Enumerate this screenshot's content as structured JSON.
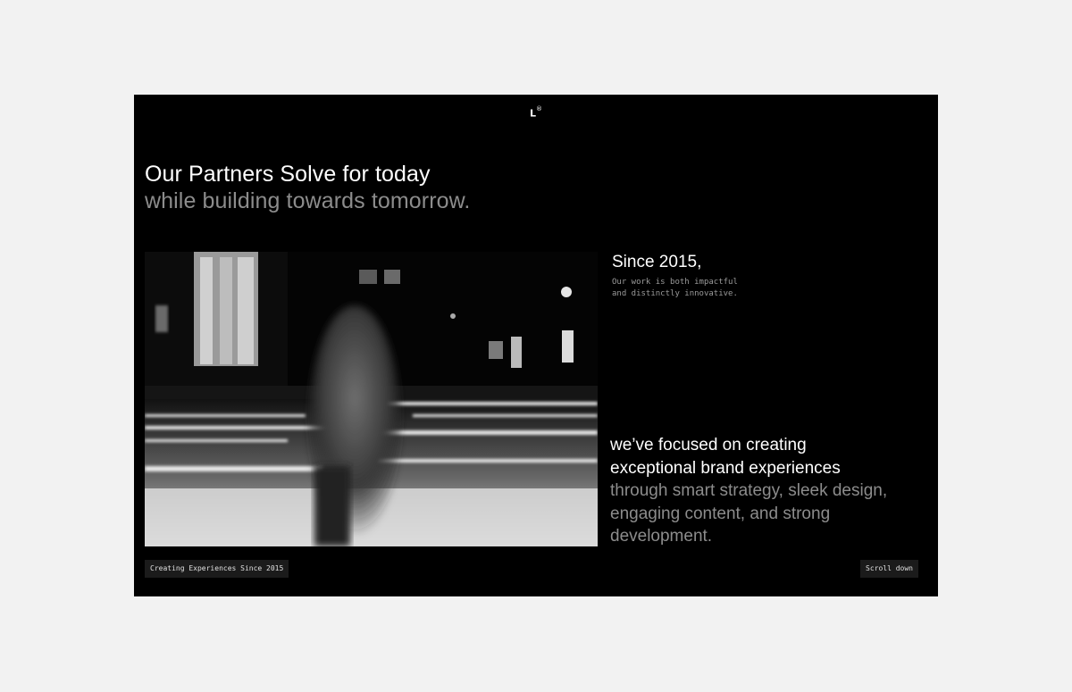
{
  "brand": {
    "logo_letter": "L",
    "logo_mark": "®"
  },
  "headline": {
    "line1": "Our Partners Solve for today",
    "line2": "while building towards tomorrow."
  },
  "intro": {
    "title": "Since 2015,",
    "subtitle_lines": [
      "Our work is both impactful",
      "and distinctly innovative."
    ]
  },
  "focus": {
    "highlight_lines": [
      "we’ve focused on creating",
      "exceptional brand experiences"
    ],
    "muted_lines": [
      "through smart strategy, sleek design,",
      "engaging content, and strong",
      "development."
    ]
  },
  "footer": {
    "left_tag": "Creating Experiences Since 2015",
    "right_button": "Scroll down"
  },
  "colors": {
    "page_bg": "#f2f2f2",
    "frame_bg": "#000000",
    "text_primary": "#ffffff",
    "text_muted": "#8c8c8c",
    "tag_bg": "#1b1b1b"
  }
}
